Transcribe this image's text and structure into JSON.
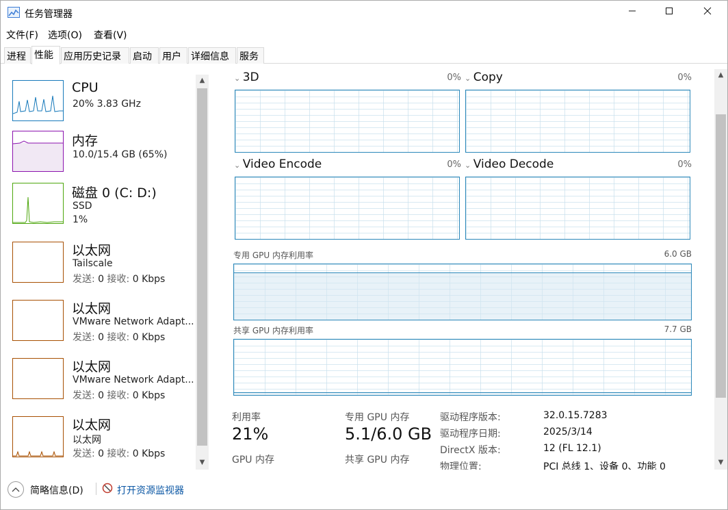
{
  "window": {
    "title": "任务管理器"
  },
  "menu": {
    "file": "文件(F)",
    "options": "选项(O)",
    "view": "查看(V)"
  },
  "tabs": [
    "进程",
    "性能",
    "应用历史记录",
    "启动",
    "用户",
    "详细信息",
    "服务"
  ],
  "sidebar": {
    "items": [
      {
        "title": "CPU",
        "line1": "20%  3.83 GHz",
        "color": "#1779ba"
      },
      {
        "title": "内存",
        "line1": "10.0/15.4 GB (65%)",
        "color": "#8b12ae"
      },
      {
        "title": "磁盘 0 (C: D:)",
        "line1": "SSD",
        "line2": "1%",
        "color": "#4da60c"
      },
      {
        "title": "以太网",
        "line1": "Tailscale",
        "send_label": "发送:",
        "send": "0",
        "recv_label": "接收:",
        "recv": "0 Kbps",
        "color": "#a74f01"
      },
      {
        "title": "以太网",
        "line1": "VMware Network Adapt...",
        "send_label": "发送:",
        "send": "0",
        "recv_label": "接收:",
        "recv": "0 Kbps",
        "color": "#a74f01"
      },
      {
        "title": "以太网",
        "line1": "VMware Network Adapt...",
        "send_label": "发送:",
        "send": "0",
        "recv_label": "接收:",
        "recv": "0 Kbps",
        "color": "#a74f01"
      },
      {
        "title": "以太网",
        "line1": "以太网",
        "send_label": "发送:",
        "send": "0",
        "recv_label": "接收:",
        "recv": "0 Kbps",
        "color": "#a74f01"
      }
    ]
  },
  "graphs": [
    {
      "name": "3D",
      "pct": "0%"
    },
    {
      "name": "Copy",
      "pct": "0%"
    },
    {
      "name": "Video Encode",
      "pct": "0%"
    },
    {
      "name": "Video Decode",
      "pct": "0%"
    }
  ],
  "dedicated_memory": {
    "label": "专用 GPU 内存利用率",
    "max": "6.0 GB",
    "usage_fraction": 0.85
  },
  "shared_memory": {
    "label": "共享 GPU 内存利用率",
    "max": "7.7 GB",
    "usage_fraction": 0.05
  },
  "stats": {
    "utilization_label": "利用率",
    "utilization": "21%",
    "dedicated_label": "专用 GPU 内存",
    "dedicated": "5.1/6.0 GB",
    "gpu_mem_label": "GPU 内存",
    "shared_label": "共享 GPU 内存"
  },
  "info": [
    {
      "label": "驱动程序版本:",
      "value": "32.0.15.7283"
    },
    {
      "label": "驱动程序日期:",
      "value": "2025/3/14"
    },
    {
      "label": "DirectX 版本:",
      "value": "12 (FL 12.1)"
    },
    {
      "label": "物理位置:",
      "value": "PCI 总线 1、设备 0、功能 0"
    }
  ],
  "bottom": {
    "summary": "简略信息(D)",
    "monitor": "打开资源监视器"
  },
  "icons": {
    "minimize": "minimize-icon",
    "maximize": "maximize-icon",
    "close": "close-icon",
    "collapse": "chevron-up-icon",
    "monitor": "resource-monitor-icon"
  }
}
